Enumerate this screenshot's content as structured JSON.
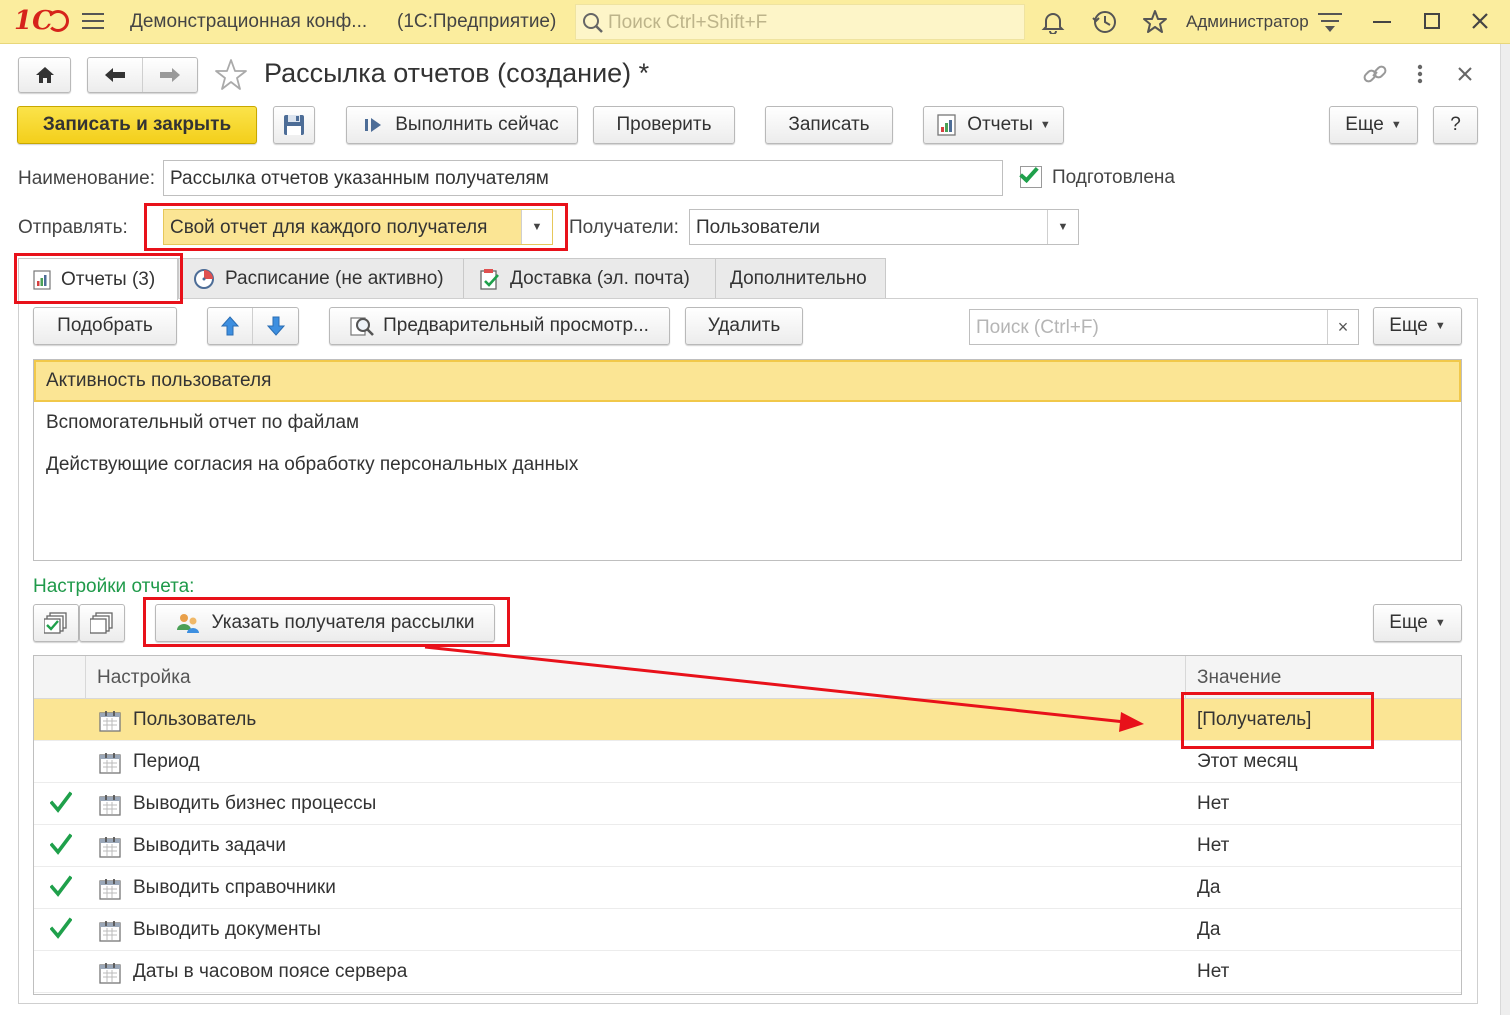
{
  "app": {
    "logo": "1С",
    "title": "Демонстрационная конф...",
    "platform": "(1С:Предприятие)",
    "search_placeholder": "Поиск Ctrl+Shift+F",
    "user": "Администратор",
    "icons": [
      "menu-icon",
      "bell-icon",
      "history-icon",
      "star-icon",
      "settings-icon",
      "minimize-icon",
      "maximize-icon",
      "close-icon"
    ]
  },
  "form": {
    "title": "Рассылка отчетов (создание) *",
    "toolbar": {
      "save_close": "Записать и закрыть",
      "run_now": "Выполнить сейчас",
      "check": "Проверить",
      "save": "Записать",
      "reports": "Отчеты",
      "more": "Еще",
      "help": "?"
    },
    "name_label": "Наименование:",
    "name_value": "Рассылка отчетов указанным получателям",
    "prepared_label": "Подготовлена",
    "prepared_checked": true,
    "send_label": "Отправлять:",
    "send_value": "Свой отчет для каждого получателя",
    "recipients_label": "Получатели:",
    "recipients_value": "Пользователи"
  },
  "tabs": [
    {
      "label": "Отчеты (3)",
      "active": true
    },
    {
      "label": "Расписание (не активно)",
      "active": false
    },
    {
      "label": "Доставка (эл. почта)",
      "active": false
    },
    {
      "label": "Дополнительно",
      "active": false
    }
  ],
  "reports_toolbar": {
    "pick": "Подобрать",
    "preview": "Предварительный просмотр...",
    "delete": "Удалить",
    "search_placeholder": "Поиск (Ctrl+F)",
    "clear": "×",
    "more": "Еще"
  },
  "reports": [
    {
      "name": "Активность пользователя",
      "selected": true
    },
    {
      "name": "Вспомогательный отчет по файлам",
      "selected": false
    },
    {
      "name": "Действующие согласия на обработку персональных данных",
      "selected": false
    }
  ],
  "settings": {
    "title": "Настройки отчета:",
    "specify_recipient": "Указать получателя рассылки",
    "more": "Еще",
    "col_setting": "Настройка",
    "col_value": "Значение",
    "rows": [
      {
        "checked": false,
        "has_checkbox": false,
        "name": "Пользователь",
        "value": "[Получатель]",
        "selected": true
      },
      {
        "checked": false,
        "has_checkbox": false,
        "name": "Период",
        "value": "Этот месяц",
        "selected": false
      },
      {
        "checked": true,
        "has_checkbox": true,
        "name": "Выводить бизнес процессы",
        "value": "Нет",
        "selected": false
      },
      {
        "checked": true,
        "has_checkbox": true,
        "name": "Выводить задачи",
        "value": "Нет",
        "selected": false
      },
      {
        "checked": true,
        "has_checkbox": true,
        "name": "Выводить справочники",
        "value": "Да",
        "selected": false
      },
      {
        "checked": true,
        "has_checkbox": true,
        "name": "Выводить документы",
        "value": "Да",
        "selected": false
      },
      {
        "checked": false,
        "has_checkbox": false,
        "name": "Даты в часовом поясе сервера",
        "value": "Нет",
        "selected": false
      }
    ]
  },
  "colors": {
    "topbar": "#fbed9e",
    "primary_button": "#f5d52a",
    "selection": "#fbe594",
    "highlight_frame": "#e8111a",
    "section_title": "#1f9a4a",
    "check": "#1fa04b"
  }
}
